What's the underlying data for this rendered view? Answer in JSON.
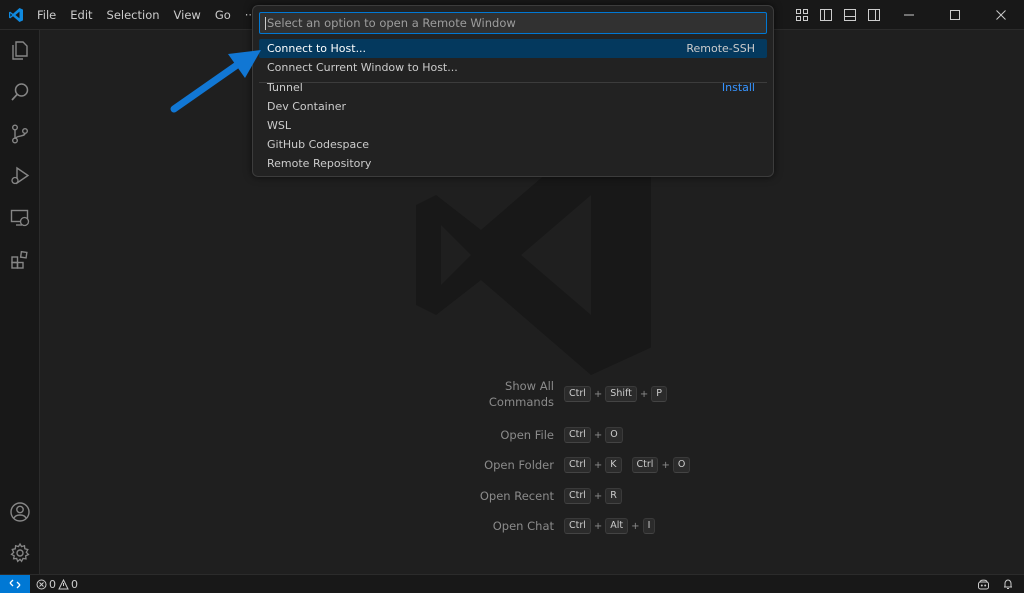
{
  "titlebar": {
    "menu": [
      "File",
      "Edit",
      "Selection",
      "View",
      "Go",
      "···"
    ],
    "layout_icons": [
      "customize-layout-icon",
      "toggle-primary-sidebar-icon",
      "toggle-panel-icon",
      "toggle-secondary-sidebar-icon"
    ],
    "window_controls": [
      "minimize-icon",
      "maximize-icon",
      "close-icon"
    ]
  },
  "activity_bar": {
    "top": [
      "explorer-icon",
      "search-icon",
      "source-control-icon",
      "run-debug-icon",
      "remote-explorer-icon",
      "extensions-icon"
    ],
    "bottom": [
      "accounts-icon",
      "manage-gear-icon"
    ]
  },
  "quick_pick": {
    "placeholder": "Select an option to open a Remote Window",
    "items": [
      {
        "label": "Connect to Host...",
        "detail": "Remote-SSH",
        "selected": true
      },
      {
        "label": "Connect Current Window to Host...",
        "detail": ""
      },
      {
        "label": "Tunnel",
        "detail": "Install"
      },
      {
        "label": "Dev Container",
        "detail": ""
      },
      {
        "label": "WSL",
        "detail": ""
      },
      {
        "label": "GitHub Codespace",
        "detail": ""
      },
      {
        "label": "Remote Repository",
        "detail": ""
      }
    ]
  },
  "shortcuts": {
    "show_all_1": "Show All",
    "show_all_2": "Commands",
    "show_all_keys": [
      "Ctrl",
      "Shift",
      "P"
    ],
    "open_file": "Open File",
    "open_file_keys": [
      "Ctrl",
      "O"
    ],
    "open_folder": "Open Folder",
    "open_folder_keys_a": [
      "Ctrl",
      "K"
    ],
    "open_folder_keys_b": [
      "Ctrl",
      "O"
    ],
    "open_recent": "Open Recent",
    "open_recent_keys": [
      "Ctrl",
      "R"
    ],
    "open_chat": "Open Chat",
    "open_chat_keys": [
      "Ctrl",
      "Alt",
      "I"
    ]
  },
  "status_bar": {
    "errors": "0",
    "warnings": "0"
  },
  "colors": {
    "accent": "#0078d4",
    "selection": "#04395e",
    "link": "#3794ff",
    "arrow": "#1177d4"
  }
}
